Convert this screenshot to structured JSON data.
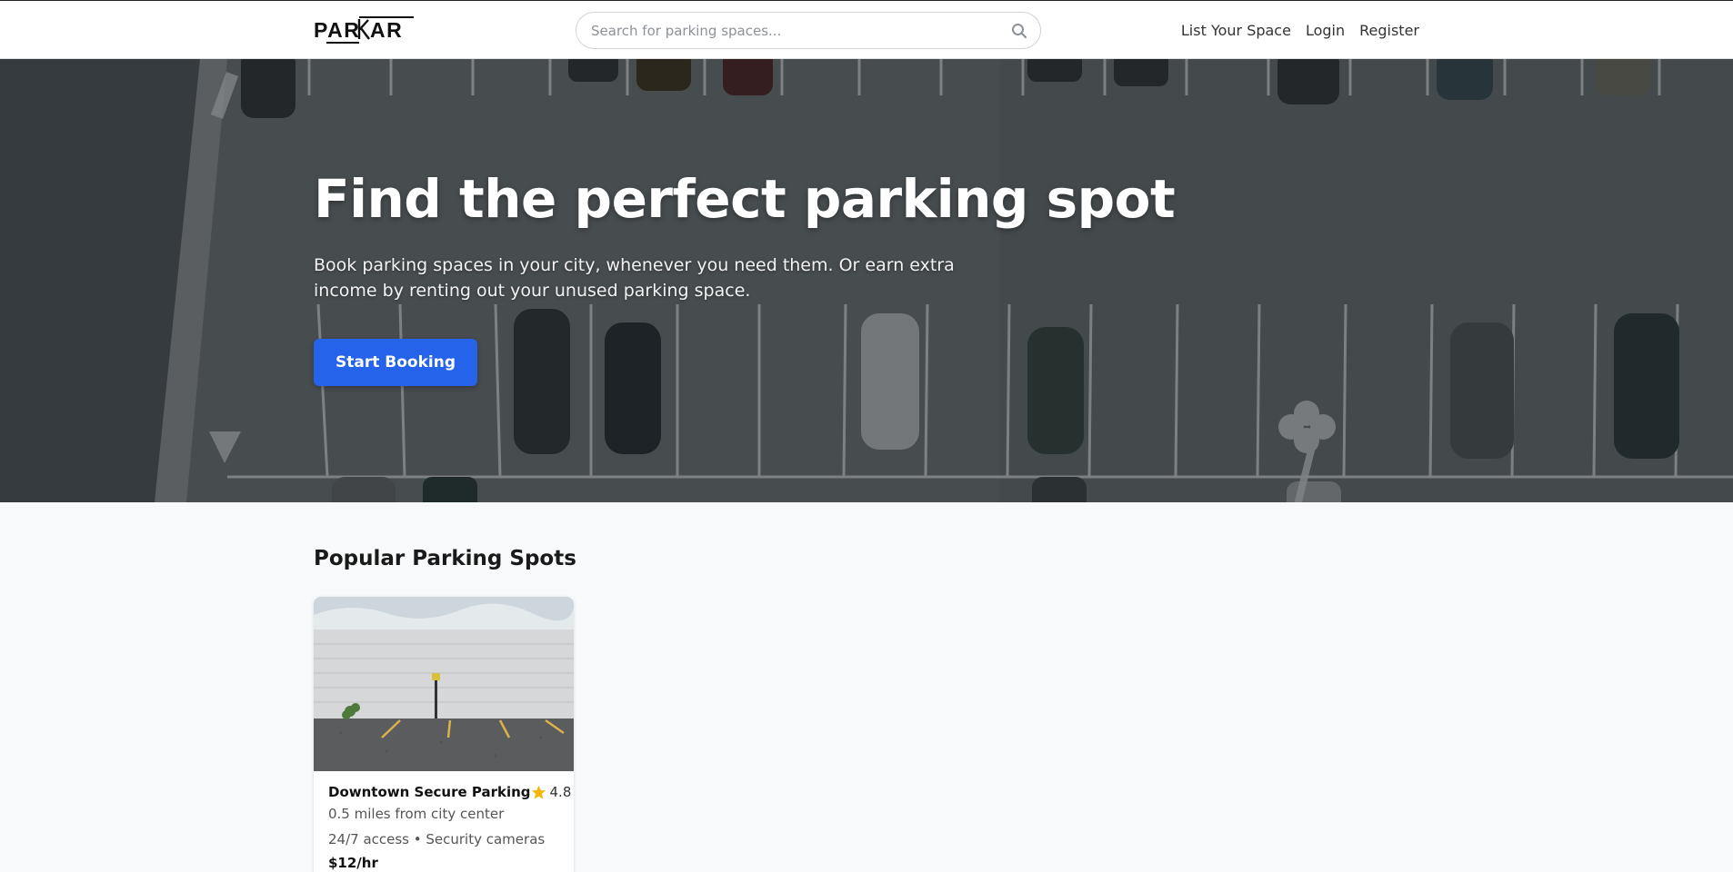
{
  "navbar": {
    "logo_text": "PARKAR",
    "search": {
      "placeholder": "Search for parking spaces...",
      "value": ""
    },
    "links": [
      {
        "label": "List Your Space"
      },
      {
        "label": "Login"
      },
      {
        "label": "Register"
      }
    ]
  },
  "hero": {
    "title": "Find the perfect parking spot",
    "subtitle": "Book parking spaces in your city, whenever you need them. Or earn extra income by renting out your unused parking space.",
    "cta_label": "Start Booking",
    "bg_color": "#5c6165"
  },
  "popular": {
    "title": "Popular Parking Spots",
    "cards": [
      {
        "name": "Downtown Secure Parking",
        "rating": "4.8",
        "distance": "0.5 miles from city center",
        "features": "24/7 access • Security cameras",
        "price": "$12/hr"
      }
    ]
  },
  "colors": {
    "accent": "#2563eb",
    "star": "#f5b50a",
    "navbar_bg": "#ffffff",
    "page_bg": "#f8f9fa"
  },
  "icons": [
    "search-icon",
    "star-icon"
  ]
}
